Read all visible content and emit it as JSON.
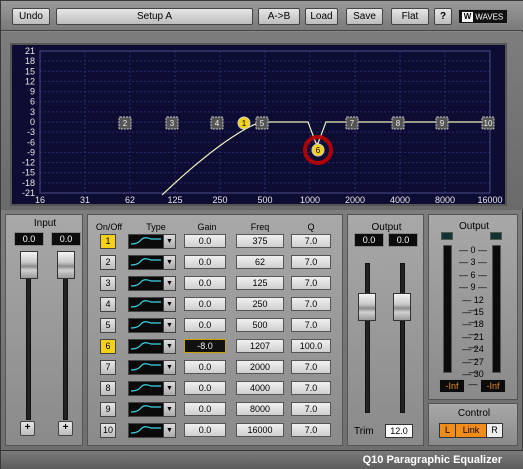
{
  "toolbar": {
    "undo": "Undo",
    "setup": "Setup A",
    "ab": "A->B",
    "load": "Load",
    "save": "Save",
    "flat": "Flat",
    "help": "?",
    "brand": "WAVES"
  },
  "graph": {
    "y_ticks": [
      "21",
      "18",
      "15",
      "12",
      "9",
      "6",
      "3",
      "0",
      "-3",
      "-6",
      "-9",
      "-12",
      "-15",
      "-18",
      "-21"
    ],
    "x_ticks": [
      "16",
      "31",
      "62",
      "125",
      "250",
      "500",
      "1000",
      "2000",
      "4000",
      "8000",
      "16000"
    ],
    "nodes": [
      "2",
      "3",
      "4",
      "1",
      "5",
      "6",
      "7",
      "8",
      "9",
      "10"
    ]
  },
  "input": {
    "title": "Input",
    "left": "0.0",
    "right": "0.0"
  },
  "bands": {
    "headers": {
      "onoff": "On/Off",
      "type": "Type",
      "gain": "Gain",
      "freq": "Freq",
      "q": "Q"
    },
    "rows": [
      {
        "num": "1",
        "on": true,
        "gain": "0.0",
        "freq": "375",
        "q": "7.0"
      },
      {
        "num": "2",
        "on": false,
        "gain": "0.0",
        "freq": "62",
        "q": "7.0"
      },
      {
        "num": "3",
        "on": false,
        "gain": "0.0",
        "freq": "125",
        "q": "7.0"
      },
      {
        "num": "4",
        "on": false,
        "gain": "0.0",
        "freq": "250",
        "q": "7.0"
      },
      {
        "num": "5",
        "on": false,
        "gain": "0.0",
        "freq": "500",
        "q": "7.0"
      },
      {
        "num": "6",
        "on": true,
        "gain": "-8.0",
        "freq": "1207",
        "q": "100.0"
      },
      {
        "num": "7",
        "on": false,
        "gain": "0.0",
        "freq": "2000",
        "q": "7.0"
      },
      {
        "num": "8",
        "on": false,
        "gain": "0.0",
        "freq": "4000",
        "q": "7.0"
      },
      {
        "num": "9",
        "on": false,
        "gain": "0.0",
        "freq": "8000",
        "q": "7.0"
      },
      {
        "num": "10",
        "on": false,
        "gain": "0.0",
        "freq": "16000",
        "q": "7.0"
      }
    ]
  },
  "output_fader": {
    "title": "Output",
    "left": "0.0",
    "right": "0.0",
    "trim_label": "Trim",
    "trim": "12.0"
  },
  "output_meter": {
    "title": "Output",
    "scale": [
      "0",
      "3",
      "6",
      "9",
      "12",
      "15",
      "18",
      "21",
      "24",
      "27",
      "30"
    ],
    "left_peak": "-Inf",
    "right_peak": "-Inf"
  },
  "control": {
    "title": "Control",
    "l": "L",
    "link": "Link",
    "r": "R"
  },
  "footer": {
    "title": "Q10 Paragraphic Equalizer"
  },
  "colors": {
    "graph_bg": "#0d0d33",
    "curve": "#f0f0c0",
    "band_on": "#f5d21a",
    "selected_ring": "#c00000"
  }
}
